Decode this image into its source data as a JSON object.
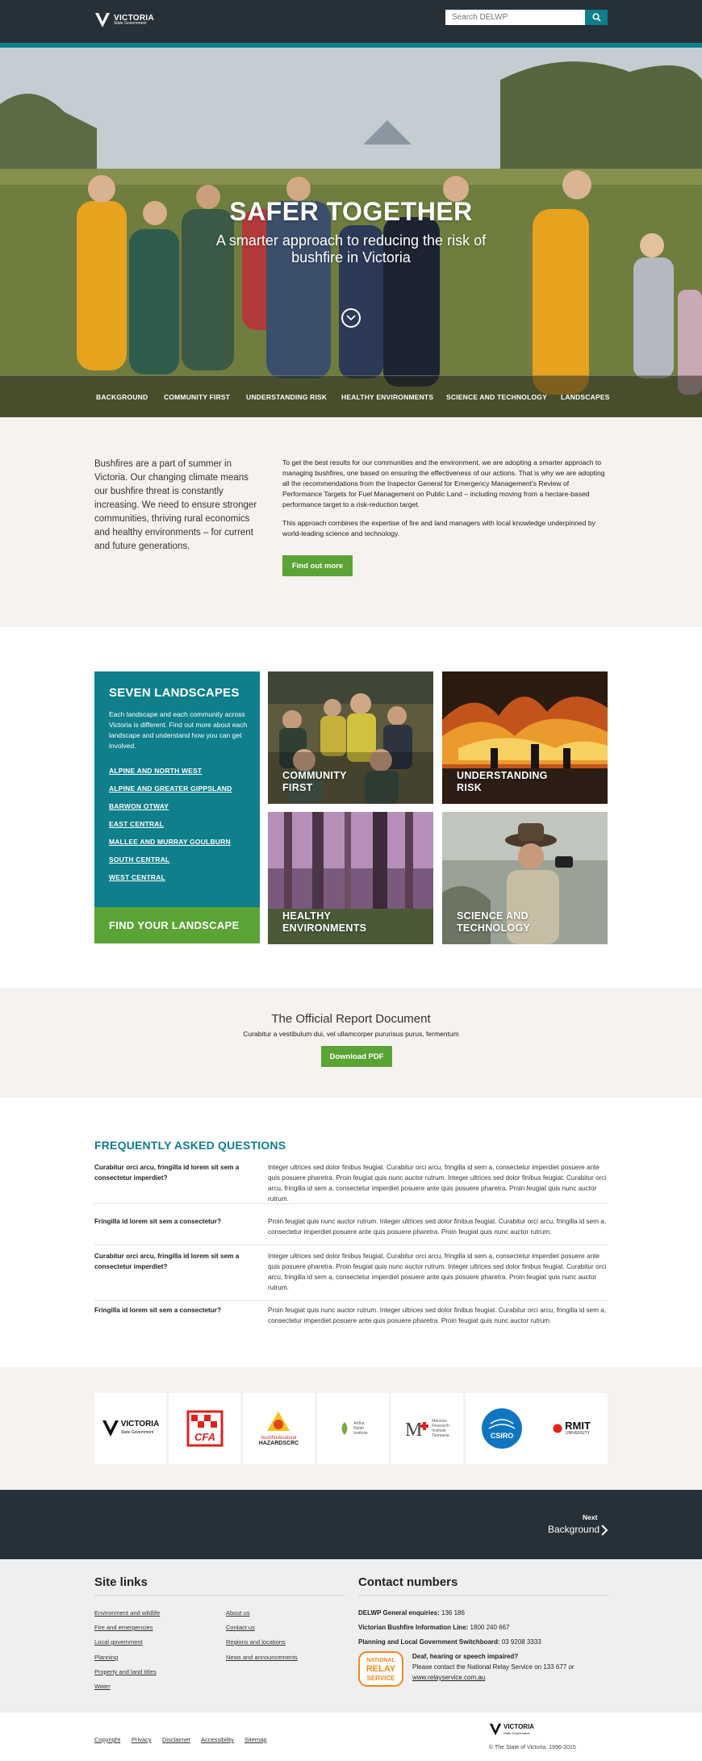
{
  "header": {
    "logo_text": "VICTORIA",
    "logo_sub": "State Government",
    "search_placeholder": "Search DELWP",
    "search_icon": "search-icon"
  },
  "hero": {
    "title": "SAFER TOGETHER",
    "subtitle": "A smarter approach to reducing the risk of bushfire in Victoria",
    "scroll_icon": "chevron-down-icon",
    "nav": [
      "BACKGROUND",
      "COMMUNITY FIRST",
      "UNDERSTANDING RISK",
      "HEALTHY ENVIRONMENTS",
      "SCIENCE AND TECHNOLOGY",
      "LANDSCAPES"
    ]
  },
  "intro": {
    "lead": "Bushfires are a part of summer in Victoria. Our changing climate means our bushfire threat is constantly increasing. We need to ensure stronger communities, thriving rural economics and healthy environments – for current and future generations.",
    "body_1": "To get the best results for our communities and the environment, we are adopting a smarter approach to managing bushfires, one based on ensuring the effectiveness of our actions. That is why we are adopting all the recommendations from the Inspector General for Emergency Management's Review of Performance Targets for Fuel Management on Public Land – including moving from a hectare-based performance target to a risk-reduction target.",
    "body_2": "This approach combines the expertise of fire and land managers with local knowledge underpinned by world-leading science and technology.",
    "button": "Find out more"
  },
  "landscapes": {
    "title": "SEVEN LANDSCAPES",
    "description": "Each landscape and each community across Victoria is different. Find out more about each landscape and understand how you can get involved.",
    "links": [
      "ALPINE AND NORTH WEST",
      "ALPINE AND GREATER GIPPSLAND",
      "BARWON OTWAY",
      "EAST CENTRAL",
      "MALLEE AND MURRAY GOULBURN",
      "SOUTH CENTRAL",
      "WEST CENTRAL"
    ],
    "find_button": "FIND YOUR LANDSCAPE",
    "tiles": [
      {
        "line1": "COMMUNITY",
        "line2": "FIRST"
      },
      {
        "line1": "UNDERSTANDING",
        "line2": "RISK"
      },
      {
        "line1": "HEALTHY",
        "line2": "ENVIRONMENTS"
      },
      {
        "line1": "SCIENCE AND",
        "line2": "TECHNOLOGY"
      }
    ]
  },
  "report": {
    "title": "The Official Report Document",
    "subtitle": "Curabitur a vestibulum dui, vel ullamcorper pururisus purus, fermentum",
    "button": "Download PDF"
  },
  "faq": {
    "title": "FREQUENTLY ASKED QUESTIONS",
    "items": [
      {
        "q": "Curabitur orci arcu, fringilla id lorem sit sem a consectetur imperdiet?",
        "a": "Integer ultrices sed dolor finibus feugiat. Curabitur orci arcu, fringilla id sem a, consectetur imperdiet posuere ante quis posuere pharetra. Proin feugiat quis nunc auctor rutrum. Integer ultrices sed dolor finibus feugiat. Curabitur orci arcu, fringilla id sem a, consectetur imperdiet posuere ante quis posuere pharetra. Proin feugiat quis nunc auctor rutrum."
      },
      {
        "q": "Fringilla id lorem sit sem a consectetur?",
        "a": "Proin feugiat quis nunc auctor rutrum. Integer ultrices sed dolor finibus feugiat. Curabitur orci arcu, fringilla id sem a, consectetur imperdiet posuere ante quis posuere pharetra. Proin feugiat quis nunc auctor rutrum."
      },
      {
        "q": "Curabitur orci arcu, fringilla id lorem sit sem a consectetur imperdiet?",
        "a": "Integer ultrices sed dolor finibus feugiat. Curabitur orci arcu, fringilla id sem a, consectetur imperdiet posuere ante quis posuere pharetra. Proin feugiat quis nunc auctor rutrum. Integer ultrices sed dolor finibus feugiat. Curabitur orci arcu, fringilla id sem a, consectetur imperdiet posuere ante quis posuere pharetra. Proin feugiat quis nunc auctor rutrum."
      },
      {
        "q": "Fringilla id lorem sit sem a consectetur?",
        "a": "Proin feugiat quis nunc auctor rutrum. Integer ultrices sed dolor finibus feugiat. Curabitur orci arcu, fringilla id sem a, consectetur imperdiet posuere ante quis posuere pharetra. Proin feugiat quis nunc auctor rutrum."
      }
    ]
  },
  "partners": {
    "victoria": {
      "name": "VICTORIA",
      "sub": "State Government"
    },
    "cfa": "CFA",
    "bnhcrc": {
      "line1": "bushfire&natural",
      "line2": "HAZARDSCRC"
    },
    "arthur_rylah": {
      "line1": "Arthur",
      "line2": "Rylah",
      "line3": "Institute"
    },
    "menzies": {
      "line1": "Menzies",
      "line2": "Research",
      "line3": "Institute",
      "line4": "Tasmania"
    },
    "csiro": "CSIRO",
    "rmit": {
      "name": "RMIT",
      "sub": "UNIVERSITY"
    }
  },
  "next": {
    "label": "Next",
    "target": "Background"
  },
  "footer": {
    "site_links_title": "Site links",
    "links_col1": [
      "Environment and wildlife",
      "Fire and emergencies",
      "Local government",
      "Planning",
      "Property and land titles",
      "Water"
    ],
    "links_col2": [
      "About us",
      "Contact us",
      "Regions and locations",
      "News and announcements"
    ],
    "contact_title": "Contact numbers",
    "contacts": [
      {
        "label": "DELWP General enquiries:",
        "value": "136 186"
      },
      {
        "label": "Victorian Bushfire Information Line:",
        "value": "1800 240 667"
      },
      {
        "label": "Planning and Local Government Switchboard:",
        "value": "03 9208 3333"
      }
    ],
    "relay_logo": {
      "line1": "NATIONAL",
      "line2": "RELAY",
      "line3": "SERVICE"
    },
    "relay_heading": "Deaf, hearing or speech impaired?",
    "relay_text": "Please contact the National Relay Service on 133 677 or",
    "relay_link": "www.relayservice.com.au"
  },
  "bottom": {
    "links": [
      "Copyright",
      "Privacy",
      "Disclaimer",
      "Accessibility",
      "Sitemap"
    ],
    "copyright": "© The State of Victoria, 1996-2015",
    "logo_text": "VICTORIA",
    "logo_sub": "State Government"
  },
  "colors": {
    "teal": "#0f7f8b",
    "green": "#5aa334",
    "dark": "#263038",
    "light_bg": "#f5f2ef"
  }
}
